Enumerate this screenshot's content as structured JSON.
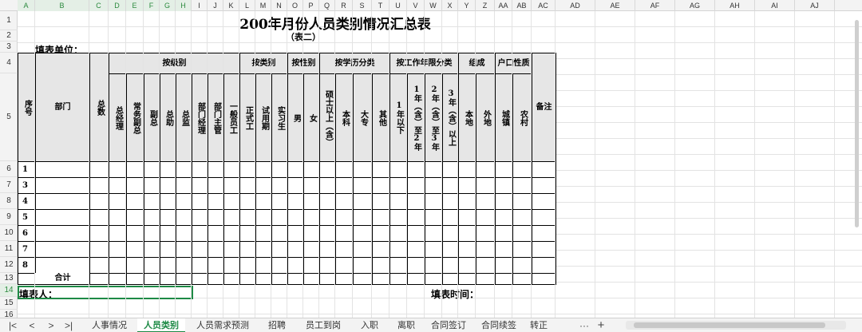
{
  "columns": [
    "A",
    "B",
    "C",
    "D",
    "E",
    "F",
    "G",
    "H",
    "I",
    "J",
    "K",
    "L",
    "M",
    "N",
    "O",
    "P",
    "Q",
    "R",
    "S",
    "T",
    "U",
    "V",
    "W",
    "X",
    "Y",
    "Z",
    "AA",
    "AB",
    "AC",
    "AD",
    "AE",
    "AF",
    "AG",
    "AH",
    "AI",
    "AJ"
  ],
  "rows": [
    "1",
    "2",
    "3",
    "4",
    "5",
    "6",
    "7",
    "8",
    "9",
    "10",
    "11",
    "12",
    "13",
    "14",
    "15",
    "16"
  ],
  "sheet": {
    "title": "200年月份人员类别情况汇总表",
    "subtitle": "（表二）",
    "unit_label": "填表单位：",
    "filler_label": "填表人：",
    "fill_time_label": "填表时间：",
    "headers": {
      "seq": "序号",
      "dept": "部门",
      "total": "总数",
      "by_level": "按级别",
      "by_type": "按类别",
      "by_gender": "按性别",
      "by_edu": "按学历分类",
      "by_years": "按工作年限分类",
      "composition": "组成",
      "hukou": "户口性质",
      "remark": "备注",
      "gm": "总经理",
      "exec_deputy": "常务副总",
      "deputy": "副总",
      "assistant": "总助",
      "director": "总监",
      "dept_mgr": "部门经理",
      "dept_head": "部门主管",
      "staff": "一般员工",
      "regular": "正式工",
      "probation": "试用期",
      "intern": "实习生",
      "male": "男",
      "female": "女",
      "master": "硕士以上（含）",
      "bachelor": "本科",
      "college": "大专",
      "other": "其他",
      "y1": "1年以下",
      "y2": "1年（含）至2年",
      "y3": "2年（含）至3年",
      "y4": "3年（含）以上",
      "local": "本地",
      "nonlocal": "外地",
      "urban": "城镇",
      "rural": "农村"
    },
    "seq_numbers": [
      "1",
      "3",
      "4",
      "5",
      "6",
      "7",
      "8"
    ],
    "total_row_label": "合计"
  },
  "tabs": [
    "人事情况",
    "人员类别",
    "人员需求预测",
    "招聘",
    "员工到岗",
    "入职",
    "离职",
    "合同签订",
    "合同续签",
    "转正"
  ],
  "active_tab": "人员类别",
  "tab_more": "···",
  "tab_add": "+",
  "nav": {
    "first": "|<",
    "prev": "<",
    "next": ">",
    "last": ">|"
  },
  "colors": {
    "accent": "#1e8a46",
    "header_fill": "#e6e6e6"
  }
}
